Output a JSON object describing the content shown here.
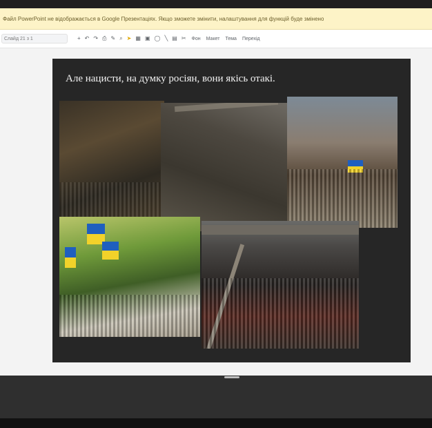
{
  "banner": {
    "text": "Файл PowerPoint не відображається в Google Презентаціях. Якщо зможете змінити, налаштування для функцій буде змінено"
  },
  "toolbar": {
    "zoom_label": "Слайд 21 з 1",
    "icons": [
      "plus-icon",
      "undo-icon",
      "redo-icon",
      "print-icon",
      "paint-format-icon",
      "zoom-icon",
      "cursor-icon",
      "frame-icon",
      "image-icon",
      "shape-icon",
      "line-icon",
      "comment-icon",
      "layout-icon"
    ],
    "items": [
      "Фон",
      "Макет",
      "Тема",
      "Перехід"
    ]
  },
  "slide": {
    "title": "Але нацисти, на думку росіян, вони якісь отакі."
  },
  "colors": {
    "banner_bg": "#fdf3c7",
    "slide_bg": "#262626",
    "accent": "#e0a800"
  }
}
